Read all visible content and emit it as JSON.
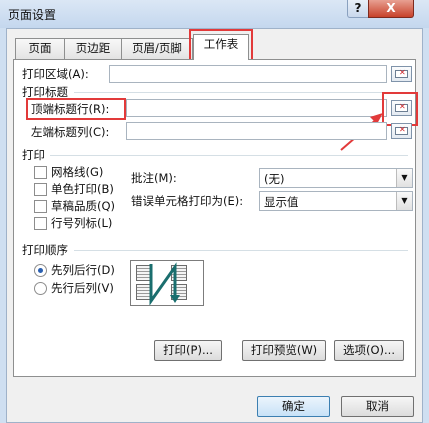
{
  "window": {
    "title": "页面设置",
    "help_label": "?",
    "close_label": "X"
  },
  "tabs": [
    {
      "label": "页面"
    },
    {
      "label": "页边距"
    },
    {
      "label": "页眉/页脚"
    },
    {
      "label": "工作表"
    }
  ],
  "sheet": {
    "print_area_label": "打印区域(A):",
    "print_area_value": "",
    "print_titles_label": "打印标题",
    "top_rows_label": "顶端标题行(R):",
    "top_rows_value": "",
    "left_cols_label": "左端标题列(C):",
    "left_cols_value": "",
    "print_section_label": "打印",
    "checkboxes": [
      {
        "label": "网格线(G)",
        "checked": false
      },
      {
        "label": "单色打印(B)",
        "checked": false
      },
      {
        "label": "草稿品质(Q)",
        "checked": false
      },
      {
        "label": "行号列标(L)",
        "checked": false
      }
    ],
    "comments_label": "批注(M):",
    "comments_value": "(无)",
    "cell_errors_label": "错误单元格打印为(E):",
    "cell_errors_value": "显示值",
    "page_order_label": "打印顺序",
    "order_options": [
      {
        "label": "先列后行(D)",
        "selected": true
      },
      {
        "label": "先行后列(V)",
        "selected": false
      }
    ]
  },
  "panel_buttons": {
    "print": "打印(P)...",
    "preview": "打印预览(W)",
    "options": "选项(O)..."
  },
  "dialog_buttons": {
    "ok": "确定",
    "cancel": "取消"
  },
  "colors": {
    "highlight": "#e23a3a"
  }
}
